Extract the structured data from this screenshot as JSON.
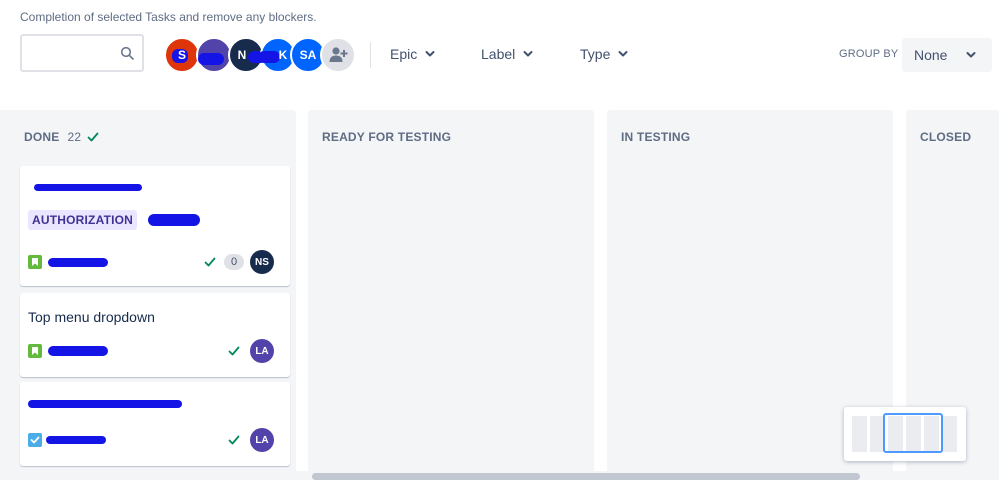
{
  "header": {
    "subtitle": "Completion of selected Tasks and remove any blockers.",
    "search_placeholder": ""
  },
  "avatars": [
    {
      "initials": "S",
      "color": "#de350b"
    },
    {
      "initials": "",
      "color": "#5243aa"
    },
    {
      "initials": "N",
      "color": "#172b4d"
    },
    {
      "initials": "K",
      "color": "#0065ff"
    },
    {
      "initials": "SA",
      "color": "#0065ff"
    }
  ],
  "filters": {
    "epic": "Epic",
    "label": "Label",
    "type": "Type"
  },
  "group_by": {
    "label": "GROUP BY",
    "value": "None"
  },
  "columns": [
    {
      "name": "DONE",
      "count": "22"
    },
    {
      "name": "READY FOR TESTING"
    },
    {
      "name": "IN TESTING"
    },
    {
      "name": "CLOSED"
    }
  ],
  "cards": [
    {
      "title": "",
      "label": "AUTHORIZATION",
      "points": "0",
      "assignee": "NS",
      "assignee_color": "#172b4d",
      "type": "story"
    },
    {
      "title": "Top menu dropdown",
      "assignee": "LA",
      "assignee_color": "#5243aa",
      "type": "story"
    },
    {
      "title": "",
      "assignee": "LA",
      "assignee_color": "#5243aa",
      "type": "task"
    }
  ],
  "colors": {
    "story": "#63ba3c",
    "task": "#4bade8",
    "check": "#00875a",
    "lozenge_bg": "#eae6ff",
    "lozenge_fg": "#403294",
    "redaction": "#1414e6"
  }
}
